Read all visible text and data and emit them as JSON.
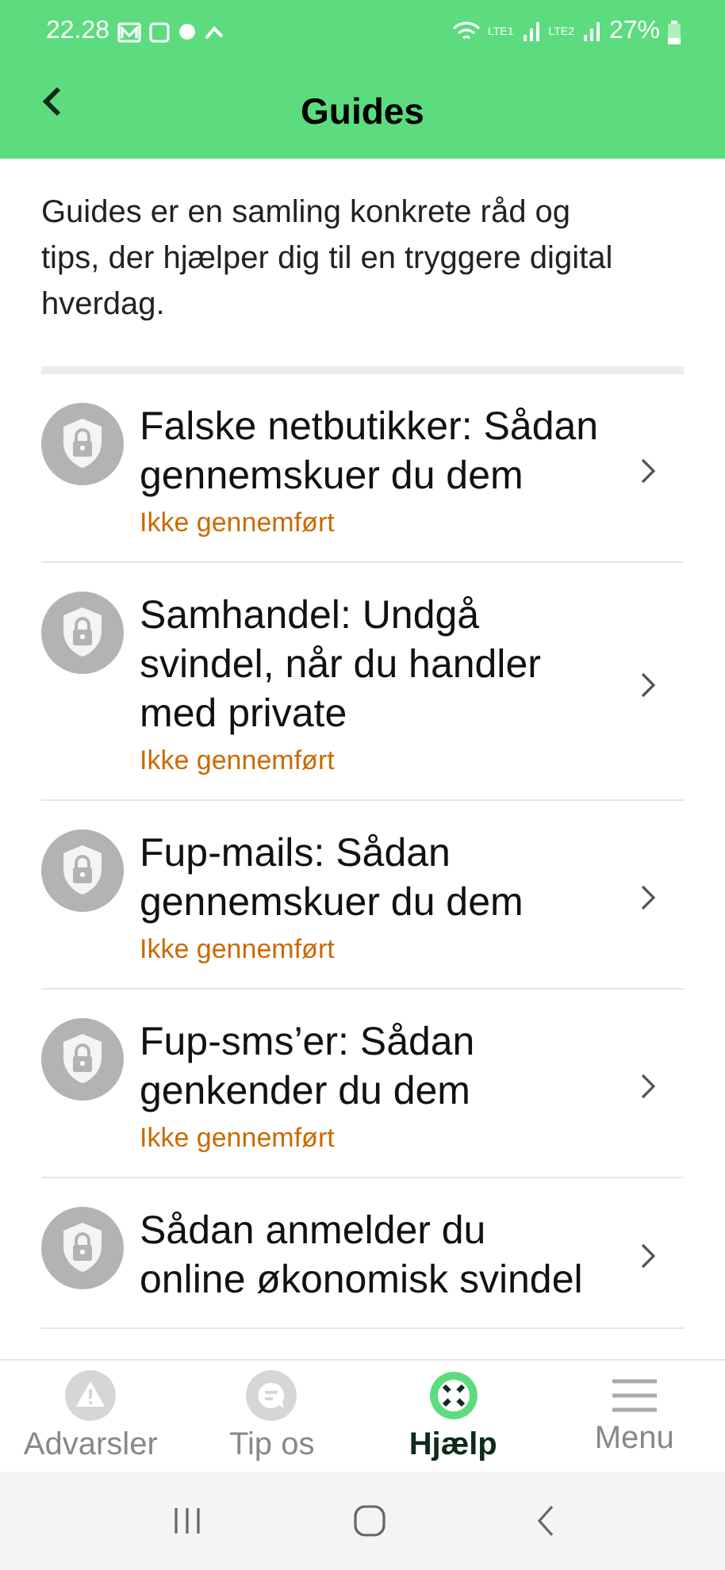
{
  "status_bar": {
    "time": "22.28",
    "sim1": "LTE1",
    "sim2": "LTE2",
    "battery": "27%"
  },
  "header": {
    "title": "Guides"
  },
  "intro": "Guides er en samling konkrete råd og tips, der hjælper dig til en tryggere digital hverdag.",
  "guides": [
    {
      "title": "Falske netbutikker: Sådan gennemskuer du dem",
      "status": "Ikke gennemført"
    },
    {
      "title": "Samhandel: Undgå svindel, når du handler med private",
      "status": "Ikke gennemført"
    },
    {
      "title": "Fup-mails: Sådan gennemskuer du dem",
      "status": "Ikke gennemført"
    },
    {
      "title": "Fup-sms’er: Sådan genkender du dem",
      "status": "Ikke gennemført"
    },
    {
      "title": "Sådan anmelder du online økonomisk svindel"
    }
  ],
  "tab_bar": [
    {
      "kind": "warning",
      "label": "Advarsler",
      "selected": false
    },
    {
      "kind": "chat",
      "label": "Tip os",
      "selected": false
    },
    {
      "kind": "help",
      "label": "Hjælp",
      "selected": true
    },
    {
      "kind": "menu",
      "label": "Menu",
      "selected": false
    }
  ]
}
